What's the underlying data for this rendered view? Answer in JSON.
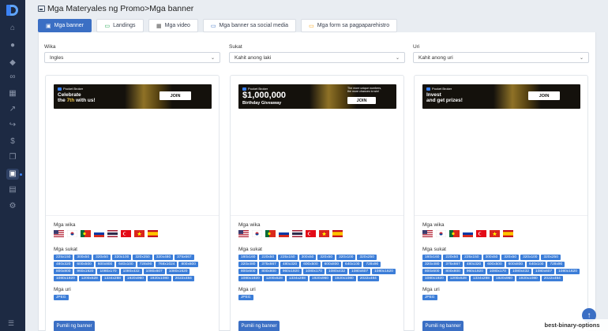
{
  "page": {
    "title": "Mga Materyales ng Promo>Mga banner"
  },
  "sidebar": {
    "icons": [
      "home-icon",
      "apple-icon",
      "diamond-icon",
      "link-icon",
      "calendar-icon",
      "chart-icon",
      "share-icon",
      "dollar-icon",
      "copy-icon",
      "banner-icon",
      "table-icon",
      "settings-icon"
    ],
    "bottom_icon": "menu-icon"
  },
  "tabs": [
    {
      "label": "Mga banner",
      "icon": "image-icon",
      "active": true
    },
    {
      "label": "Landings",
      "icon": "landing-icon",
      "active": false
    },
    {
      "label": "Mga video",
      "icon": "video-icon",
      "active": false
    },
    {
      "label": "Mga banner sa social media",
      "icon": "social-icon",
      "active": false
    },
    {
      "label": "Mga form sa pagpaparehistro",
      "icon": "form-icon",
      "active": false
    }
  ],
  "filters": {
    "language": {
      "label": "Wika",
      "value": "Ingles"
    },
    "size": {
      "label": "Sukat",
      "value": "Kahit anong laki"
    },
    "type": {
      "label": "Uri",
      "value": "Kahit anong uri"
    }
  },
  "colors": {
    "accent": "#3b6fc4",
    "sidebar": "#1d2a43",
    "chip": "#3b7dd8"
  },
  "cards": [
    {
      "banner": {
        "brand": "Pocket Broker",
        "headline_1": "Celebrate",
        "headline_2a": "the ",
        "headline_2b": "7th",
        "headline_2c": " with us!",
        "cta": "JOIN"
      },
      "languages_label": "Mga wika",
      "flags": [
        "us",
        "kr",
        "pt",
        "ru",
        "th",
        "tr",
        "vn",
        "es"
      ],
      "sizes_label": "Mga sukat",
      "sizes": [
        "225x150",
        "300x50",
        "320x50",
        "320x100",
        "320x250",
        "320x480",
        "375x667",
        "480x320",
        "600x500",
        "600x800",
        "640x100",
        "728x90",
        "768x1024",
        "800x600",
        "800x800",
        "960x1920",
        "1080x170",
        "1080x432",
        "1080x607",
        "1080x1620",
        "1080x1920",
        "1200x628",
        "1334x288",
        "1920x960",
        "1920x1080",
        "2022x484"
      ],
      "type_label": "Mga uri",
      "types": [
        "JPEG"
      ],
      "button": "Pumili ng banner"
    },
    {
      "banner": {
        "brand": "Pocket Broker",
        "amount": "$1,000,000",
        "subline": "Birthday Giveaway",
        "note": "The more unique numbers, the more chances to win!",
        "cta": "JOIN"
      },
      "languages_label": "Mga wika",
      "flags": [
        "us",
        "kr",
        "pt",
        "ru",
        "th",
        "tr",
        "vn",
        "es"
      ],
      "sizes_label": "Mga sukat",
      "sizes": [
        "160x160",
        "220x50",
        "225x150",
        "300x50",
        "320x50",
        "320x100",
        "320x250",
        "320x480",
        "375x667",
        "480x320",
        "600x500",
        "600x800",
        "640x100",
        "728x90",
        "800x600",
        "800x800",
        "960x1920",
        "1080x170",
        "1080x432",
        "1080x607",
        "1080x1620",
        "1080x1920",
        "1200x628",
        "1334x288",
        "1920x960",
        "1920x1080",
        "2022x484"
      ],
      "type_label": "Mga uri",
      "types": [
        "JPEG"
      ],
      "button": "Pumili ng banner"
    },
    {
      "banner": {
        "brand": "Pocket Broker",
        "headline_1": "Invest",
        "headline_2a": "and get prizes!",
        "cta": "JOIN"
      },
      "languages_label": "Mga wika",
      "flags": [
        "us",
        "kr",
        "pt",
        "ru",
        "tr",
        "vn",
        "es"
      ],
      "sizes_label": "Mga sukat",
      "sizes": [
        "160x160",
        "220x50",
        "225x150",
        "300x50",
        "320x50",
        "320x100",
        "320x250",
        "320x480",
        "375x667",
        "480x320",
        "600x500",
        "600x800",
        "640x100",
        "728x90",
        "800x600",
        "800x800",
        "960x1920",
        "1080x170",
        "1080x432",
        "1080x607",
        "1080x1620",
        "1080x1920",
        "1200x628",
        "1334x288",
        "1920x960",
        "1920x1080",
        "2022x484"
      ],
      "type_label": "Mga uri",
      "types": [
        "JPEG"
      ],
      "button": "Pumili ng banner"
    }
  ],
  "watermark": "best-binary-options"
}
